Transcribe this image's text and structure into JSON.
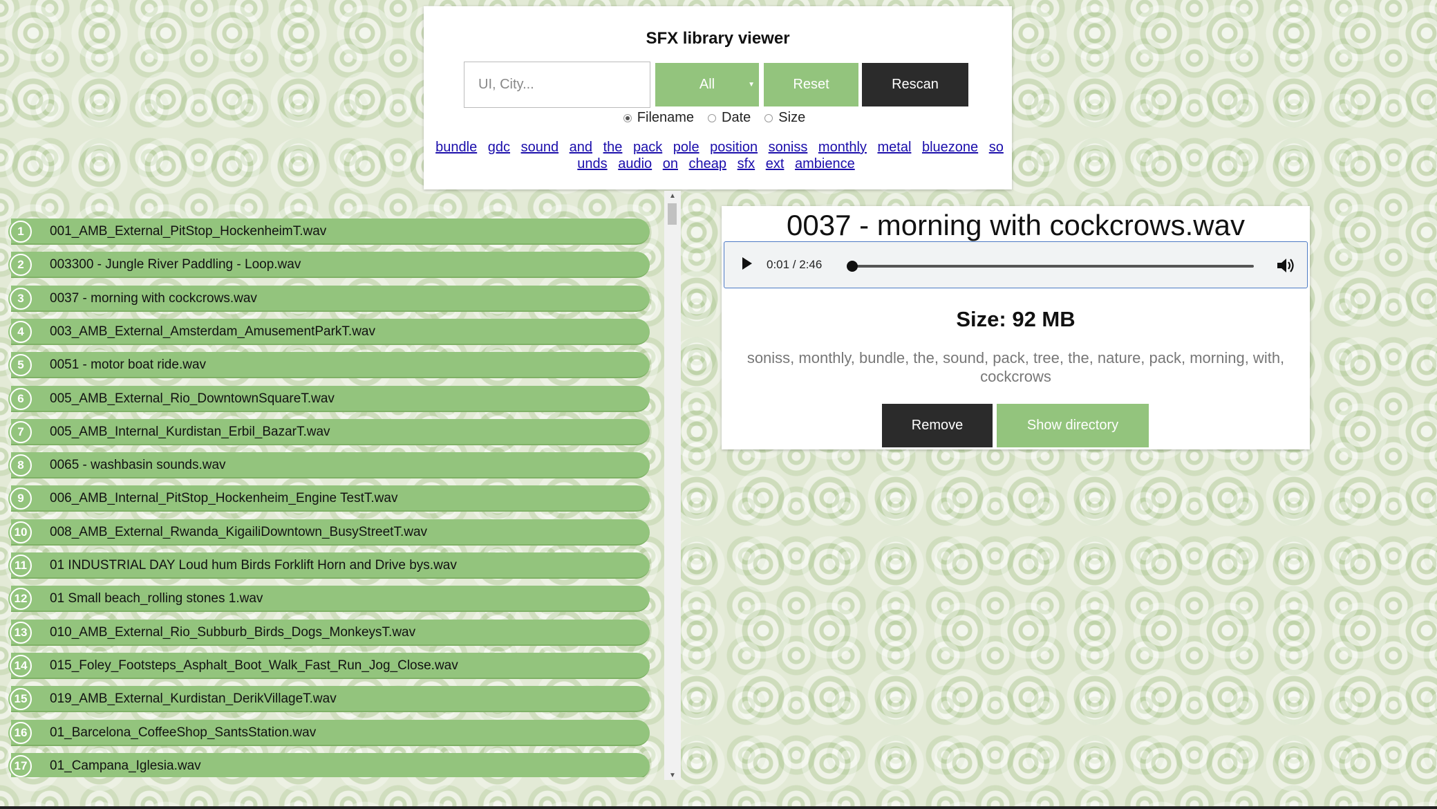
{
  "header": {
    "title": "SFX library viewer",
    "search_placeholder": "UI, City...",
    "filter_value": "All",
    "reset_label": "Reset",
    "rescan_label": "Rescan",
    "sort_options": [
      {
        "label": "Filename",
        "checked": true
      },
      {
        "label": "Date",
        "checked": false
      },
      {
        "label": "Size",
        "checked": false
      }
    ],
    "tags": [
      "bundle",
      "gdc",
      "sound",
      "and",
      "the",
      "pack",
      "pole",
      "position",
      "soniss",
      "monthly",
      "metal",
      "bluezone",
      "sounds",
      "audio",
      "on",
      "cheap",
      "sfx",
      "ext",
      "ambience"
    ]
  },
  "file_list": [
    {
      "num": "1",
      "name": "001_AMB_External_PitStop_HockenheimT.wav"
    },
    {
      "num": "2",
      "name": "003300 - Jungle River Paddling - Loop.wav"
    },
    {
      "num": "3",
      "name": "0037 - morning with cockcrows.wav"
    },
    {
      "num": "4",
      "name": "003_AMB_External_Amsterdam_AmusementParkT.wav"
    },
    {
      "num": "5",
      "name": "0051 - motor boat ride.wav"
    },
    {
      "num": "6",
      "name": "005_AMB_External_Rio_DowntownSquareT.wav"
    },
    {
      "num": "7",
      "name": "005_AMB_Internal_Kurdistan_Erbil_BazarT.wav"
    },
    {
      "num": "8",
      "name": "0065 - washbasin sounds.wav"
    },
    {
      "num": "9",
      "name": "006_AMB_Internal_PitStop_Hockenheim_Engine TestT.wav"
    },
    {
      "num": "10",
      "name": "008_AMB_External_Rwanda_KigailiDowntown_BusyStreetT.wav"
    },
    {
      "num": "11",
      "name": "01 INDUSTRIAL DAY Loud hum Birds Forklift Horn and Drive bys.wav"
    },
    {
      "num": "12",
      "name": "01 Small beach_rolling stones 1.wav"
    },
    {
      "num": "13",
      "name": "010_AMB_External_Rio_Subburb_Birds_Dogs_MonkeysT.wav"
    },
    {
      "num": "14",
      "name": "015_Foley_Footsteps_Asphalt_Boot_Walk_Fast_Run_Jog_Close.wav"
    },
    {
      "num": "15",
      "name": "019_AMB_External_Kurdistan_DerikVillageT.wav"
    },
    {
      "num": "16",
      "name": "01_Barcelona_CoffeeShop_SantsStation.wav"
    },
    {
      "num": "17",
      "name": "01_Campana_Iglesia.wav"
    }
  ],
  "detail": {
    "title": "0037 - morning with cockcrows.wav",
    "time": "0:01 / 2:46",
    "progress": 0.006,
    "size_text": "Size: 92 MB",
    "tags_text": "soniss, monthly, bundle, the, sound, pack, tree, the, nature, pack, morning, with, cockcrows",
    "remove_label": "Remove",
    "show_directory_label": "Show directory"
  }
}
